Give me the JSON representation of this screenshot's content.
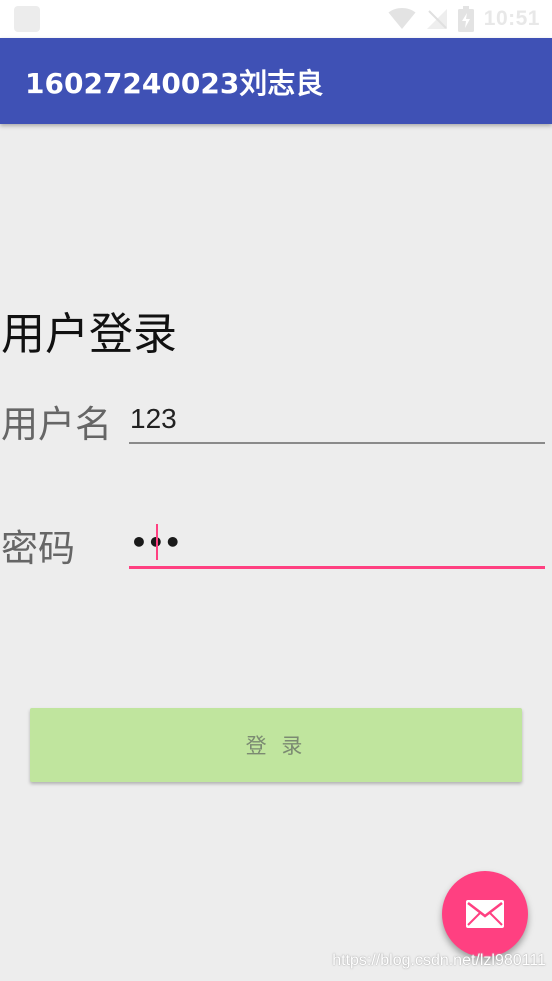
{
  "status_bar": {
    "time": "10:51",
    "icons": [
      "notification-icon",
      "wifi-icon",
      "no-signal-icon",
      "battery-charging-icon"
    ]
  },
  "app_bar": {
    "title": "16027240023刘志良"
  },
  "form": {
    "heading": "用户登录",
    "username_label": "用户名",
    "username_value": "123",
    "password_label": "密码",
    "password_value": "•••"
  },
  "login_button": {
    "label": "登 录"
  },
  "fab": {
    "icon": "email-icon"
  },
  "watermark": {
    "text": "https://blog.csdn.net/lzl980111"
  },
  "colors": {
    "primary": "#3f51b5",
    "accent": "#ff4081",
    "button_bg": "#c0e59e",
    "background": "#ededed"
  }
}
